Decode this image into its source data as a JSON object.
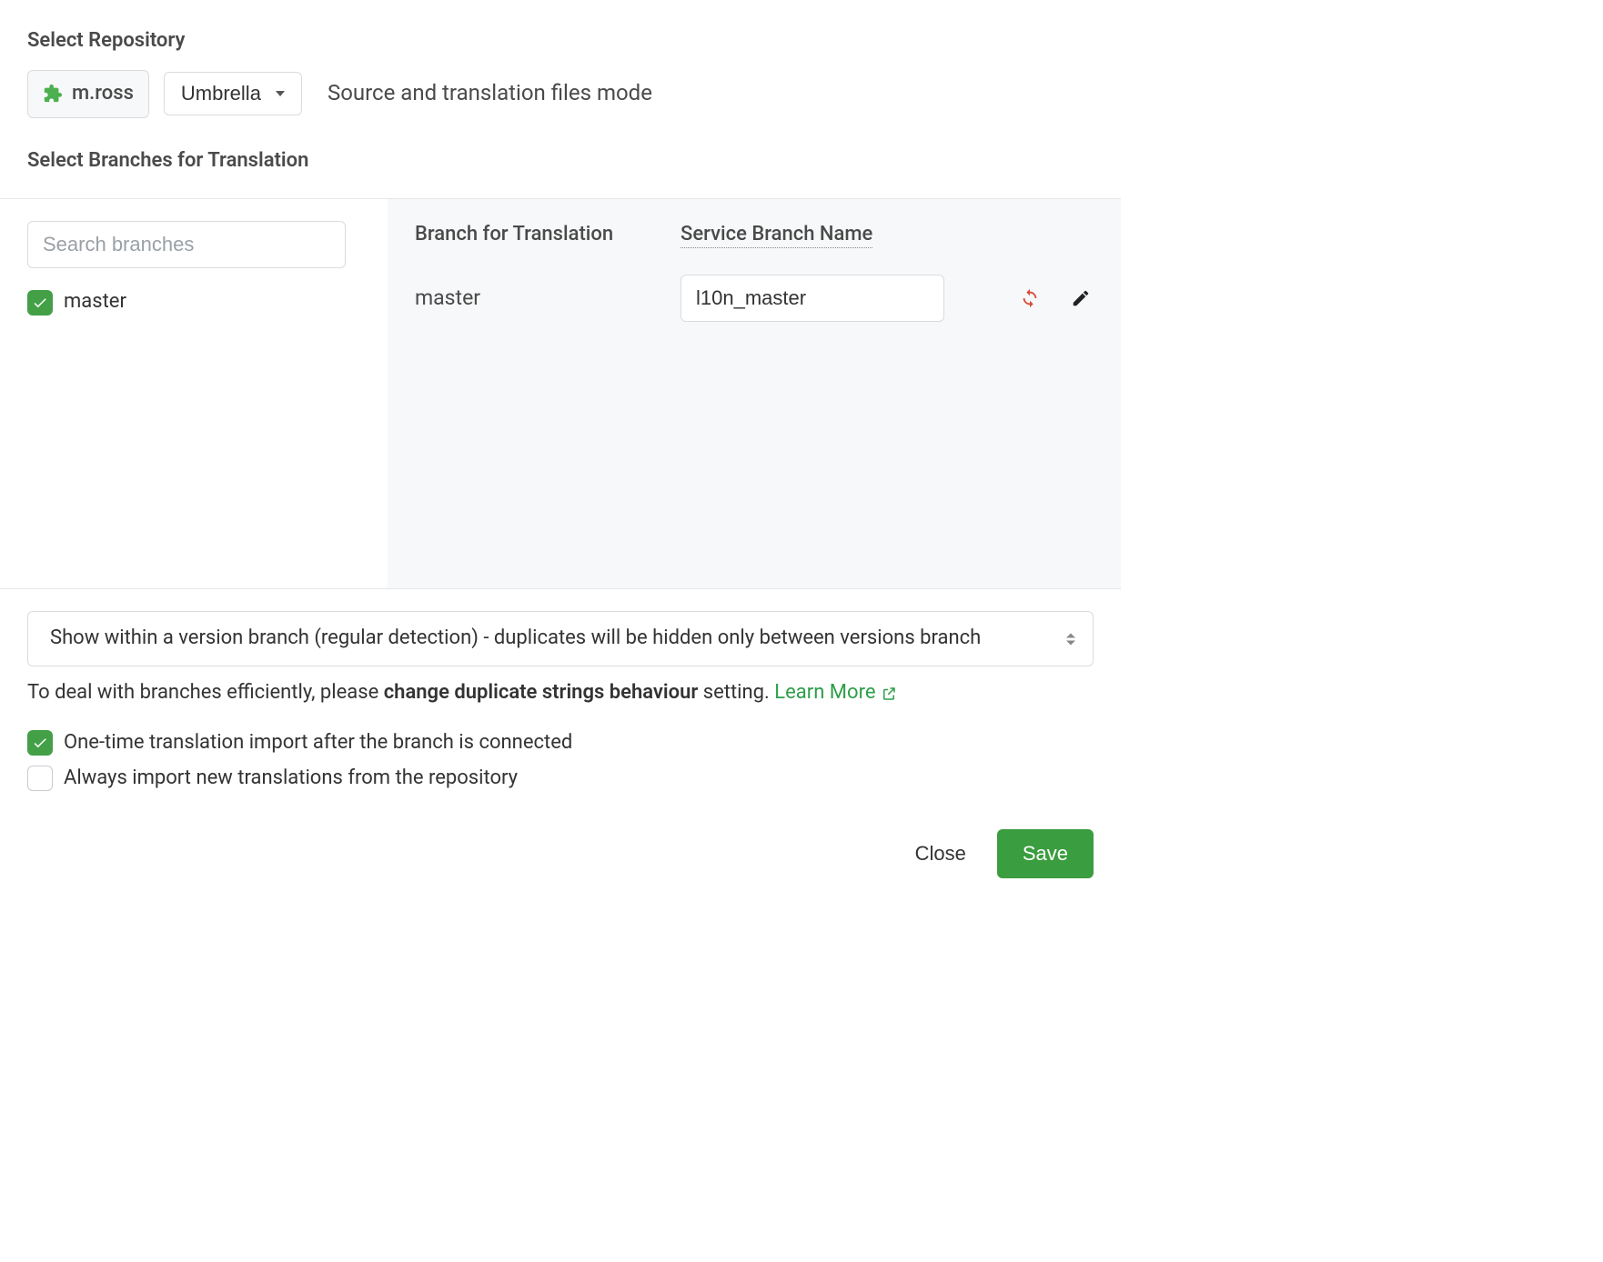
{
  "repo": {
    "heading": "Select Repository",
    "owner": "m.ross",
    "project": "Umbrella",
    "mode_label": "Source and translation files mode"
  },
  "branches": {
    "heading": "Select Branches for Translation",
    "search_placeholder": "Search branches",
    "list": [
      {
        "label": "master",
        "checked": true
      }
    ]
  },
  "right": {
    "col_branch": "Branch for Translation",
    "col_service": "Service Branch Name",
    "rows": [
      {
        "branch": "master",
        "service": "l10n_master"
      }
    ]
  },
  "settings": {
    "select_value": "Show within a version branch (regular detection) - duplicates will be hidden only between versions branch",
    "hint_prefix": "To deal with branches efficiently, please ",
    "hint_strong": "change duplicate strings behaviour",
    "hint_suffix": " setting. ",
    "learn_more": "Learn More",
    "opt_onetime": "One-time translation import after the branch is connected",
    "opt_always": "Always import new translations from the repository"
  },
  "buttons": {
    "close": "Close",
    "save": "Save"
  }
}
